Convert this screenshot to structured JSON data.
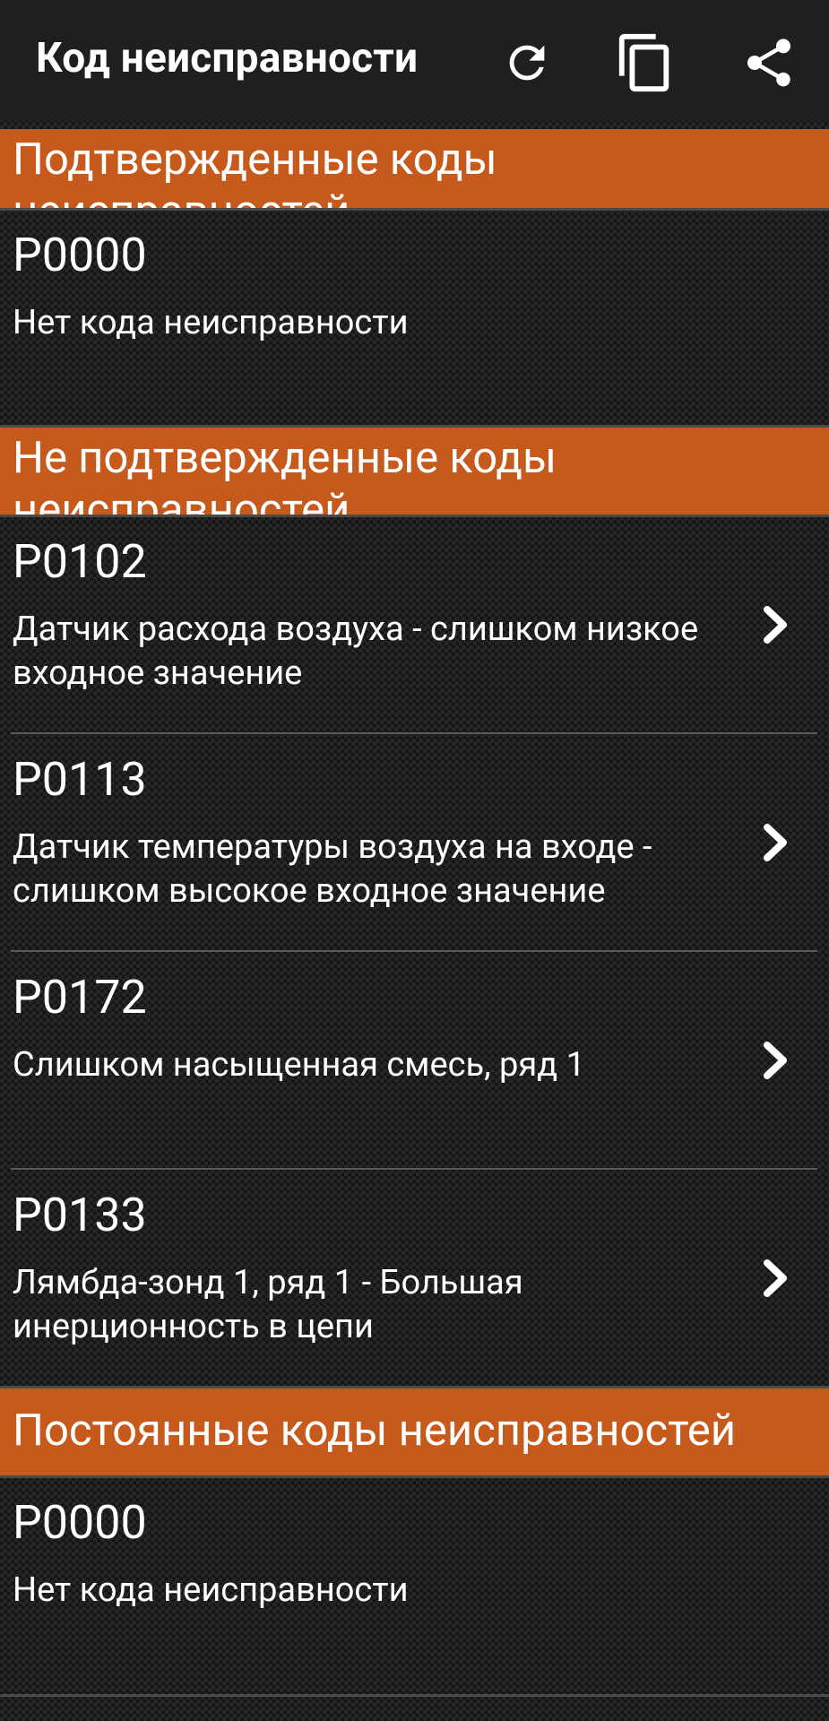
{
  "toolbar": {
    "title": "Код неисправности",
    "refresh_icon": "refresh-icon",
    "copy_icon": "copy-icon",
    "share_icon": "share-icon"
  },
  "colors": {
    "accent": "#c55a1c",
    "toolbar_bg": "#1f1f1f",
    "text": "#ffffff"
  },
  "sections": [
    {
      "title": "Подтвержденные коды неисправностей",
      "items": [
        {
          "code": "P0000",
          "description": "Нет кода неисправности",
          "has_details": false
        }
      ]
    },
    {
      "title": "Не подтвержденные коды неисправностей",
      "items": [
        {
          "code": "P0102",
          "description": "Датчик расхода воздуха - слишком низкое входное значение",
          "has_details": true
        },
        {
          "code": "P0113",
          "description": "Датчик температуры воздуха на входе - слишком высокое входное значение",
          "has_details": true
        },
        {
          "code": "P0172",
          "description": "Слишком насыщенная смесь, ряд 1",
          "has_details": true
        },
        {
          "code": "P0133",
          "description": "Лямбда-зонд 1, ряд 1 - Большая инерционность в цепи",
          "has_details": true
        }
      ]
    },
    {
      "title": "Постоянные коды неисправностей",
      "items": [
        {
          "code": "P0000",
          "description": "Нет кода неисправности",
          "has_details": false
        }
      ]
    }
  ]
}
